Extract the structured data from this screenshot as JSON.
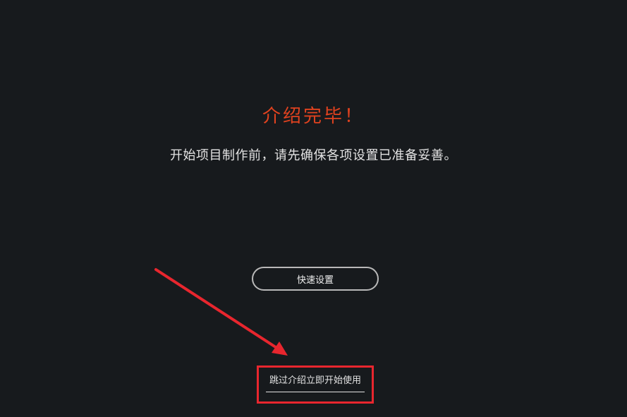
{
  "intro": {
    "title": "介绍完毕！",
    "subtitle": "开始项目制作前，请先确保各项设置已准备妥善。"
  },
  "actions": {
    "quick_setup_label": "快速设置",
    "skip_label": "跳过介绍立即开始使用"
  },
  "annotation": {
    "color": "#e8262e"
  },
  "colors": {
    "background": "#171a1d",
    "title": "#e0421f",
    "text": "#e3e3e3"
  }
}
